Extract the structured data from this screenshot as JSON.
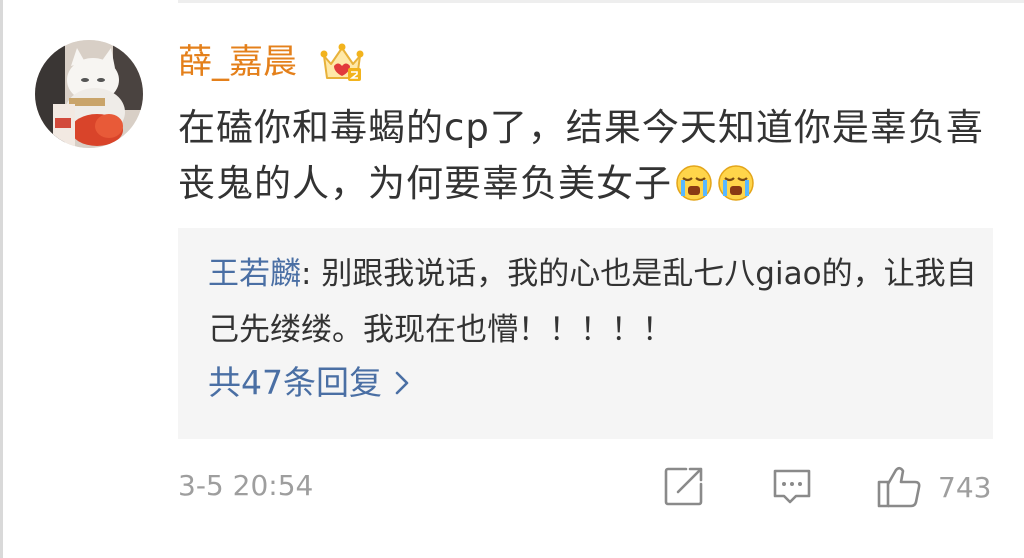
{
  "comment": {
    "username": "薛_嘉晨",
    "text": "在磕你和毒蝎的cp了，结果今天知道你是辜负喜丧鬼的人，为何要辜负美女子",
    "emojis": [
      "crying-emoji",
      "crying-emoji"
    ],
    "timestamp": "3-5 20:54",
    "like_count": "743"
  },
  "reply": {
    "author": "王若麟",
    "separator": ": ",
    "text": "别跟我说话，我的心也是乱七八giao的，让我自己先缕缕。我现在也懵！！！！！",
    "count_label": "共47条回复"
  },
  "colors": {
    "username": "#e4801b",
    "link": "#4a6fa4",
    "text": "#333333",
    "muted": "#9e9e9e",
    "reply_bg": "#f5f5f5"
  },
  "icons": {
    "badge": "crown-badge-icon",
    "share": "share-icon",
    "comment": "comment-icon",
    "like": "thumbs-up-icon",
    "chevron": "chevron-right-icon"
  }
}
